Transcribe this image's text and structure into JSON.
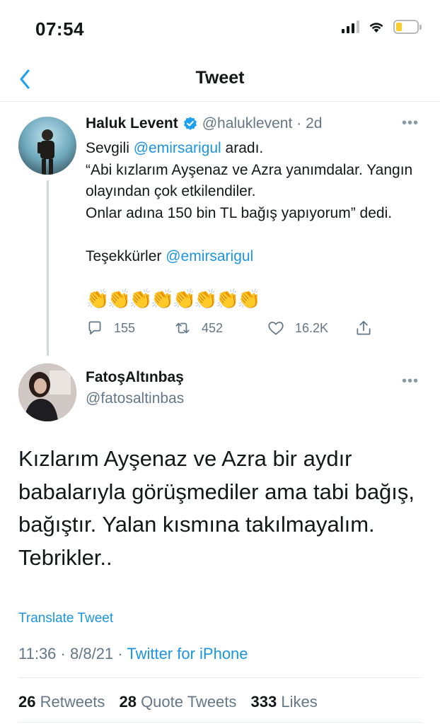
{
  "status_bar": {
    "time": "07:54",
    "battery_level": 0.3
  },
  "nav": {
    "title": "Tweet"
  },
  "original_tweet": {
    "author_name": "Haluk Levent",
    "handle": "@haluklevent",
    "age": "· 2d",
    "text_part1": "Sevgili ",
    "mention1": "@emirsarigul",
    "text_part2": " aradı.\n“Abi kızlarım Ayşenaz ve Azra yanımdalar. Yangın olayından çok etkilendiler.\nOnlar adına 150 bin TL bağış yapıyorum” dedi.\n\nTeşekkürler ",
    "mention2": "@emirsarigul",
    "claps": "👏👏👏👏👏👏👏👏",
    "reply_count": "155",
    "retweet_count": "452",
    "like_count": "16.2K"
  },
  "reply_tweet": {
    "author_name": "FatoşAltınbaş",
    "handle": "@fatosaltinbas",
    "text": "Kızlarım Ayşenaz ve Azra bir aydır babalarıyla görüşmediler ama tabi bağış, bağıştır. Yalan kısmına takılmayalım. Tebrikler..",
    "translate_label": "Translate Tweet",
    "time": "11:36",
    "date": "8/8/21",
    "source": "Twitter for iPhone",
    "retweets_count": "26",
    "retweets_label": "Retweets",
    "quotes_count": "28",
    "quotes_label": "Quote Tweets",
    "likes_count": "333",
    "likes_label": "Likes"
  },
  "colors": {
    "link_blue": "#1b95e0",
    "gray_text": "#657786",
    "battery_yellow": "#f7ce2e"
  },
  "icons": [
    "back-chevron-icon",
    "verified-badge-icon",
    "more-icon",
    "reply-icon",
    "retweet-icon",
    "like-icon",
    "share-icon",
    "signal-icon",
    "wifi-icon",
    "battery-icon"
  ]
}
